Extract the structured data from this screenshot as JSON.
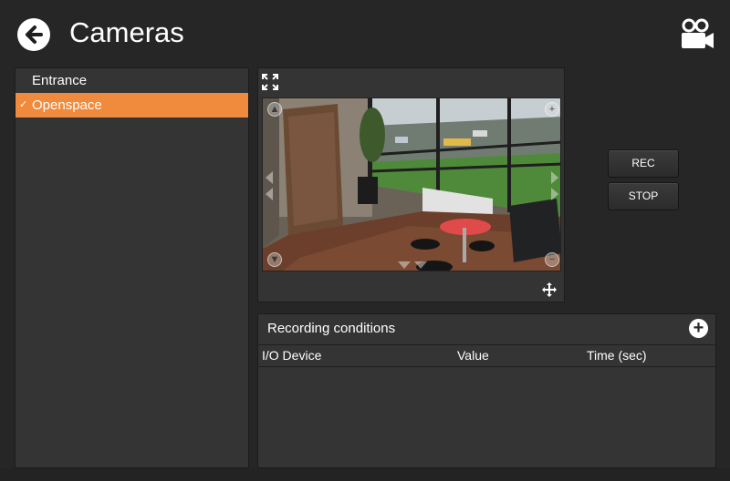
{
  "header": {
    "title": "Cameras",
    "back_icon": "arrow-left-icon",
    "camera_icon": "video-camera-icon"
  },
  "camera_list": {
    "items": [
      {
        "label": "Entrance",
        "selected": false
      },
      {
        "label": "Openspace",
        "selected": true
      }
    ],
    "selected_check": "✓",
    "accent_color": "#f08a3c"
  },
  "video": {
    "fullscreen_icon": "fullscreen-icon",
    "move_icon": "move-arrows-icon"
  },
  "controls": {
    "rec_label": "REC",
    "stop_label": "STOP"
  },
  "recording_conditions": {
    "title": "Recording conditions",
    "add_icon": "plus-icon",
    "add_label": "+",
    "columns": [
      "I/O Device",
      "Value",
      "Time (sec)"
    ],
    "rows": []
  }
}
